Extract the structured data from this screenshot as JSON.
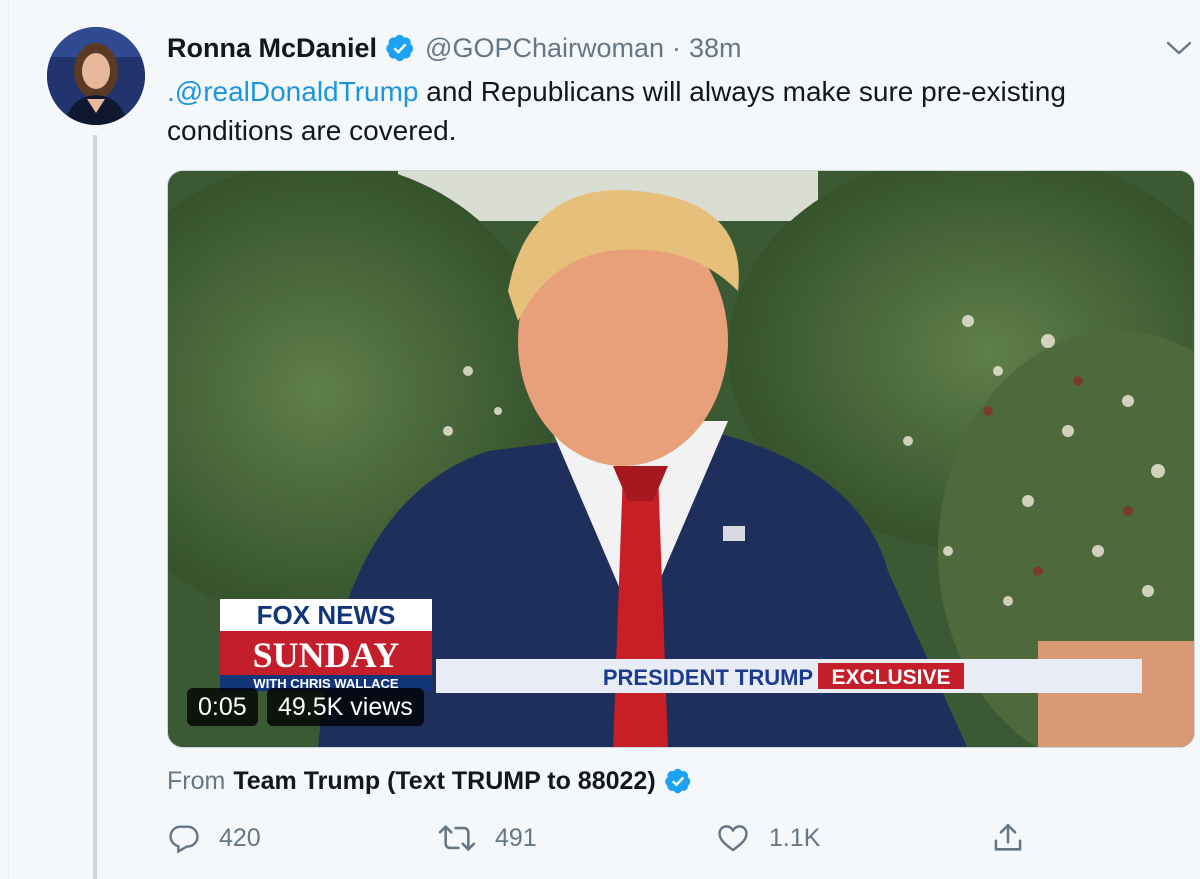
{
  "tweet": {
    "author_name": "Ronna McDaniel",
    "author_handle": "@GOPChairwoman",
    "separator": "·",
    "time": "38m",
    "mention": ".@realDonaldTrump",
    "body": " and Republicans will always make sure pre-existing conditions are covered."
  },
  "video": {
    "duration": "0:05",
    "views": "49.5K views",
    "overlay": {
      "network": "FOX NEWS",
      "show": "SUNDAY",
      "host": "WITH CHRIS WALLACE",
      "lower_third": "PRESIDENT TRUMP",
      "tag": "EXCLUSIVE"
    }
  },
  "source": {
    "label": "From",
    "name": "Team Trump (Text TRUMP to 88022)"
  },
  "actions": {
    "reply_count": "420",
    "retweet_count": "491",
    "like_count": "1.1K"
  },
  "icons": [
    "verified-badge-icon",
    "chevron-down-icon",
    "reply-icon",
    "retweet-icon",
    "like-icon",
    "share-icon"
  ],
  "colors": {
    "accent": "#1da1f2",
    "mention": "#1b95e0",
    "muted": "#657786",
    "text": "#14171a"
  }
}
